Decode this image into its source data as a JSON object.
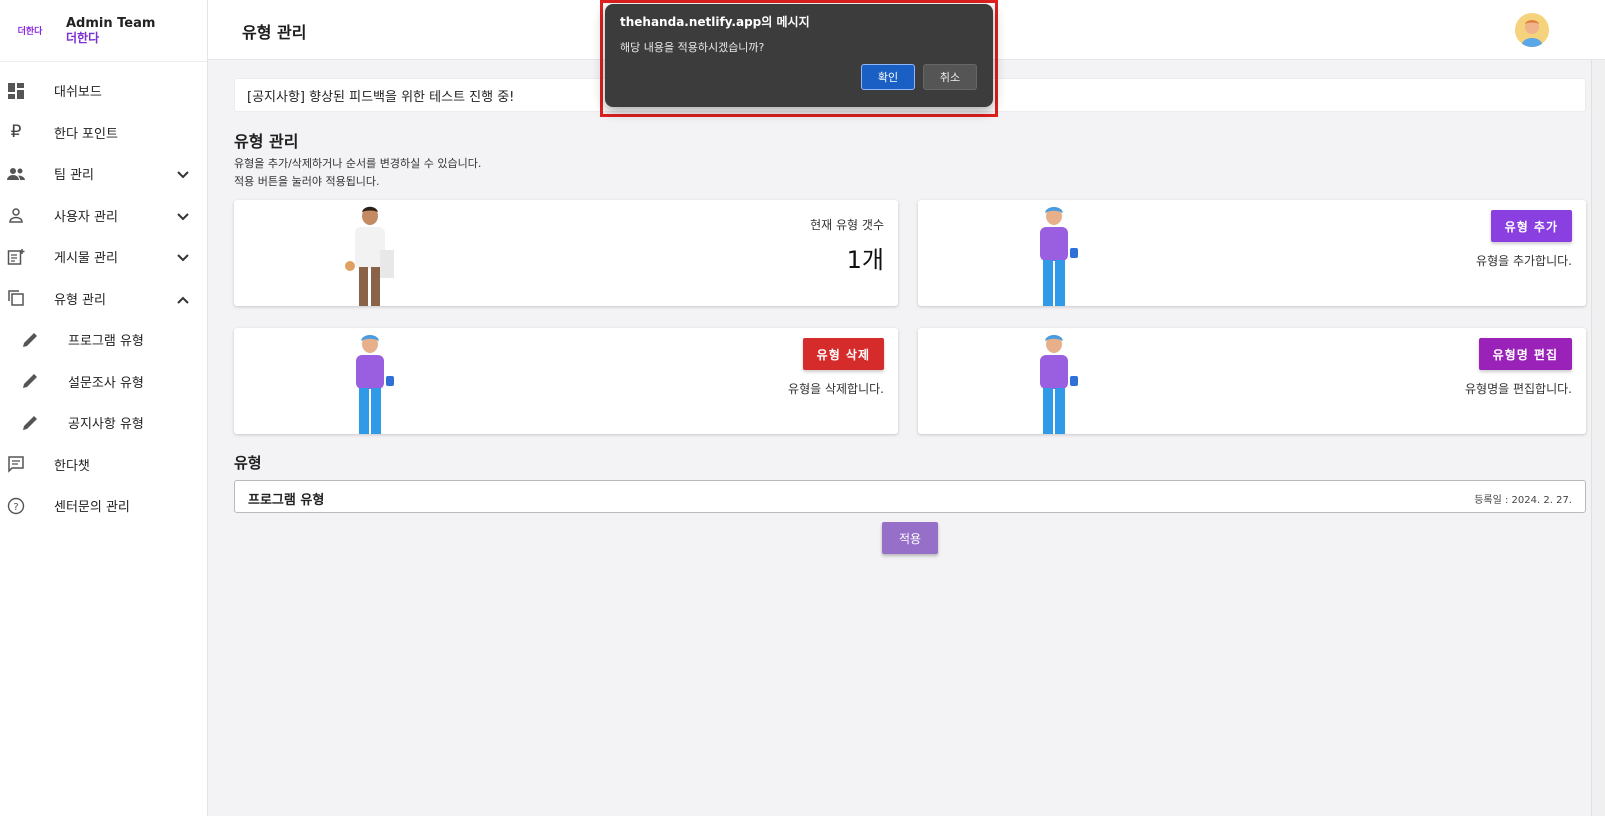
{
  "brand": {
    "logo_text": "더한다",
    "title": "Admin Team",
    "subtitle": "더한다"
  },
  "sidebar": {
    "items": [
      {
        "label": "대쉬보드",
        "icon": "dashboard-icon"
      },
      {
        "label": "한다 포인트",
        "icon": "ruble-icon"
      },
      {
        "label": "팀 관리",
        "icon": "people-icon",
        "chevron": "down"
      },
      {
        "label": "사용자 관리",
        "icon": "person-icon",
        "chevron": "down"
      },
      {
        "label": "게시물 관리",
        "icon": "post-add-icon",
        "chevron": "down"
      },
      {
        "label": "유형 관리",
        "icon": "copy-icon",
        "chevron": "up"
      },
      {
        "label": "프로그램 유형",
        "icon": "pencil-icon"
      },
      {
        "label": "설문조사 유형",
        "icon": "pencil-icon"
      },
      {
        "label": "공지사항 유형",
        "icon": "pencil-icon"
      },
      {
        "label": "한다챗",
        "icon": "chat-icon"
      },
      {
        "label": "센터문의 관리",
        "icon": "help-icon"
      }
    ]
  },
  "header": {
    "title": "유형 관리"
  },
  "notice": {
    "text": "[공지사항] 향상된 피드백을 위한 테스트 진행 중!"
  },
  "main": {
    "title": "유형 관리",
    "desc1": "유형을 추가/삭제하거나 순서를 변경하실 수 있습니다.",
    "desc2": "적용 버튼을 눌러야 적용됩니다."
  },
  "cards": {
    "count": {
      "label": "현재 유형 갯수",
      "value": "1개"
    },
    "add": {
      "button": "유형 추가",
      "desc": "유형을 추가합니다.",
      "color": "#8a3fe0"
    },
    "delete": {
      "button": "유형 삭제",
      "desc": "유형을 삭제합니다.",
      "color": "#d62b2b"
    },
    "edit": {
      "button": "유형명 편집",
      "desc": "유형명을 편집합니다.",
      "color": "#9b22b8"
    }
  },
  "types": {
    "heading": "유형",
    "rows": [
      {
        "name": "프로그램 유형",
        "date": "등록일 : 2024. 2. 27."
      }
    ]
  },
  "apply_button": "적용",
  "dialog": {
    "title": "thehanda.netlify.app의 메시지",
    "message": "해당 내용을 적용하시겠습니까?",
    "ok": "확인",
    "cancel": "취소"
  }
}
